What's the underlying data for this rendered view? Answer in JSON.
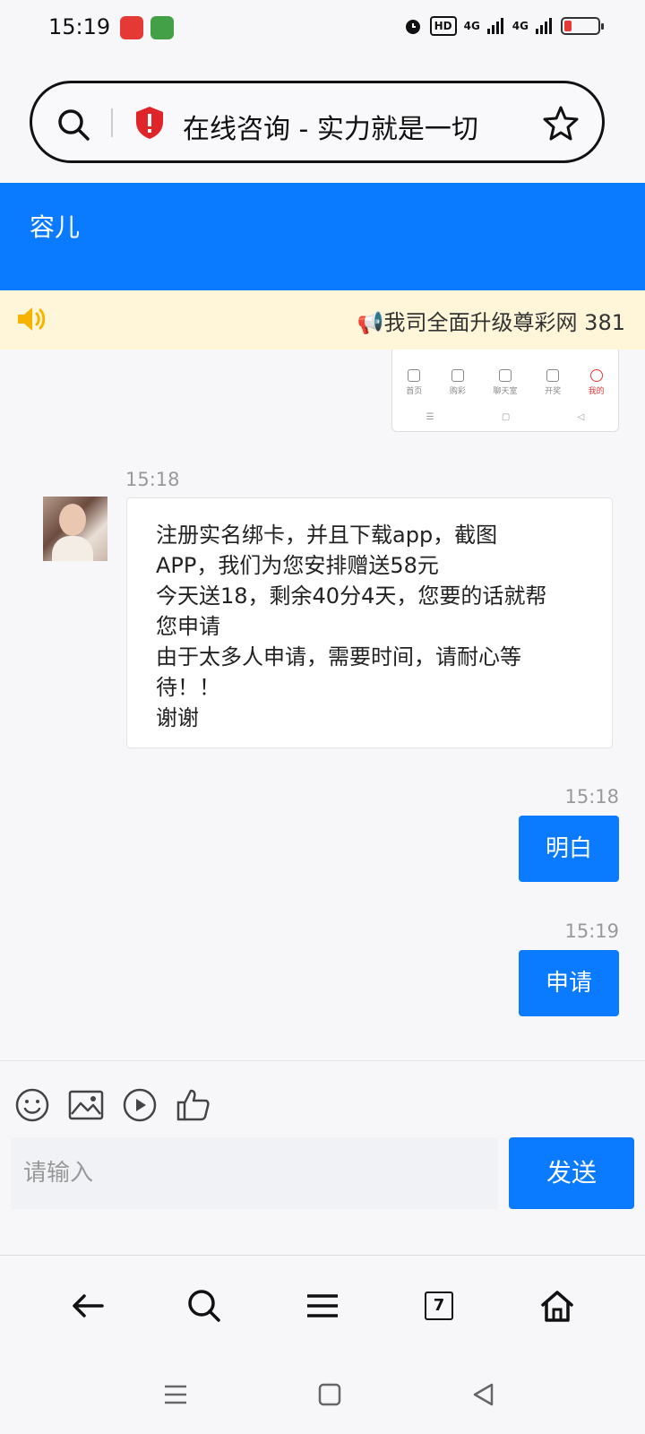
{
  "status_bar": {
    "time": "15:19",
    "hd_label": "HD",
    "net_1": "4G",
    "net_2": "4G"
  },
  "browser": {
    "title": "在线咨询 - 实力就是一切",
    "tab_count": "7"
  },
  "chat": {
    "contact_name": "容儿",
    "notice_text": "📢我司全面升级尊彩网 381",
    "screenshot_tabs": [
      "首页",
      "购彩",
      "聊天室",
      "开奖",
      "我的"
    ],
    "messages": [
      {
        "time": "15:18",
        "lines": [
          "注册实名绑卡，并且下载app，截图",
          "APP，我们为您安排赠送58元",
          "今天送18，剩余40分4天，您要的话就帮",
          "您申请",
          "由于太多人申请，需要时间，请耐心等",
          "待！！",
          "谢谢"
        ]
      },
      {
        "time": "15:18",
        "text": "明白"
      },
      {
        "time": "15:19",
        "text": "申请"
      }
    ]
  },
  "composer": {
    "placeholder": "请输入",
    "send_label": "发送"
  },
  "colors": {
    "accent": "#0a7bff",
    "notice_bg": "#fff6d9"
  }
}
